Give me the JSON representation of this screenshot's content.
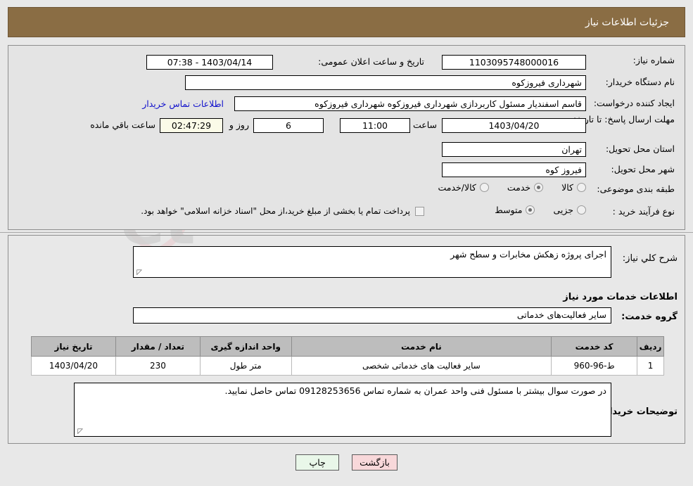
{
  "header": {
    "title": "جزئیات اطلاعات نیاز"
  },
  "watermark": {
    "text": "AriaTender.net",
    "shield_color": "#e9c9cb",
    "text_color": "#cfcfcf"
  },
  "form": {
    "need_number": {
      "label": "شماره نیاز:",
      "value": "1103095748000016"
    },
    "public_announce": {
      "label": "تاریخ و ساعت اعلان عمومی:",
      "value": "1403/04/14 - 07:38"
    },
    "buyer_org": {
      "label": "نام دستگاه خریدار:",
      "value": "شهرداری فیروزکوه"
    },
    "request_creator": {
      "label": "ایجاد کننده درخواست:",
      "value": "قاسم اسفندیار مسئول کاربردازی شهرداری فیروزکوه شهرداری فیروزکوه",
      "contact_link": "اطلاعات تماس خریدار"
    },
    "deadline": {
      "label": "مهلت ارسال پاسخ: تا تاریخ:",
      "date": "1403/04/20",
      "hour_label": "ساعت",
      "hour_value": "11:00",
      "days_value": "6",
      "days_label": "روز و",
      "countdown": "02:47:29",
      "countdown_label": "ساعت باقي مانده"
    },
    "delivery_province": {
      "label": "استان محل تحویل:",
      "value": "تهران"
    },
    "delivery_city": {
      "label": "شهر محل تحویل:",
      "value": "فیروز کوه"
    },
    "category": {
      "label": "طبقه بندی موضوعی:",
      "options": [
        {
          "label": "کالا",
          "selected": false
        },
        {
          "label": "خدمت",
          "selected": true
        },
        {
          "label": "کالا/خدمت",
          "selected": false
        }
      ]
    },
    "purchase_type": {
      "label": "نوع فرآیند خرید :",
      "options": [
        {
          "label": "جزیی",
          "selected": false
        },
        {
          "label": "متوسط",
          "selected": true
        }
      ],
      "checkbox_label": "پرداخت تمام یا بخشی از مبلغ خرید،از محل \"اسناد خزانه اسلامی\" خواهد بود.",
      "checkbox_checked": false
    },
    "general_desc": {
      "label": "شرح کلي نیاز:",
      "value": "اجرای پروژه زهکش مخابرات و سطح شهر"
    },
    "services_section_title": "اطلاعات خدمات مورد نیاز",
    "service_group": {
      "label": "گروه خدمت:",
      "value": "سایر فعالیت‌های خدماتی"
    },
    "buyer_notes": {
      "label": "توضیحات خریدار:",
      "value": "در صورت سوال بیشتر با مسئول فنی واحد عمران به شماره تماس 09128253656 تماس حاصل نمایید."
    }
  },
  "table": {
    "columns": [
      "ردیف",
      "کد خدمت",
      "نام خدمت",
      "واحد اندازه گیری",
      "تعداد / مقدار",
      "تاریخ نیاز"
    ],
    "rows": [
      {
        "row_no": "1",
        "service_code": "ط-96-960",
        "service_name": "سایر فعالیت های خدماتی شخصی",
        "unit": "متر طول",
        "quantity": "230",
        "need_date": "1403/04/20"
      }
    ]
  },
  "footer": {
    "print_button": "چاپ",
    "back_button": "بازگشت"
  },
  "colors": {
    "header_bg": "#8a6d44",
    "page_bg": "#e8e8e8",
    "panel_bg": "#e4e4e4",
    "link": "#1111cc",
    "print_btn_bg": "#e9f7e9",
    "back_btn_bg": "#f8d8da",
    "table_header_bg": "#bdbdbd",
    "countdown_bg": "#fbfbe8"
  }
}
